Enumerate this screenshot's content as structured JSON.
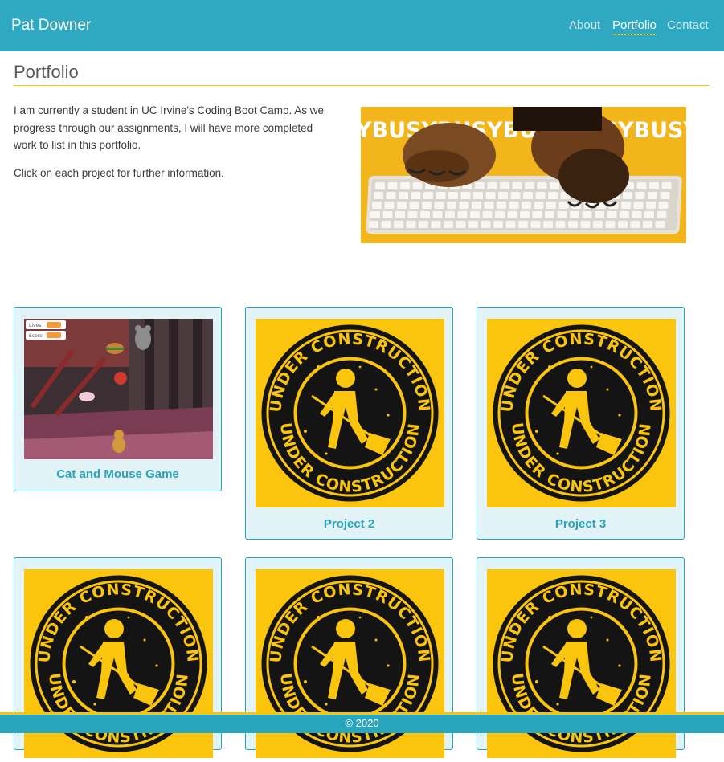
{
  "site": {
    "brand": "Pat Downer"
  },
  "nav": {
    "items": [
      {
        "label": "About",
        "active": false
      },
      {
        "label": "Portfolio",
        "active": true
      },
      {
        "label": "Contact",
        "active": false
      }
    ]
  },
  "page": {
    "title": "Portfolio",
    "intro": [
      "I am currently a student in UC Irvine's Coding Boot Camp. As we progress through our assignments, I will have more completed work to list in this portfolio.",
      "Click on each project for further information."
    ]
  },
  "hero": {
    "banner_text": "YBUSYBUSYBUSYBUSYBUSYBUSYBUSYB"
  },
  "game_thumb": {
    "hud_lives": "Lives",
    "hud_score": "Score"
  },
  "stamp": {
    "text": "UNDER CONSTRUCTION"
  },
  "projects": [
    {
      "title": "Cat and Mouse Game"
    },
    {
      "title": "Project 2"
    },
    {
      "title": "Project 3"
    },
    {
      "title": ""
    },
    {
      "title": ""
    },
    {
      "title": ""
    }
  ],
  "footer": {
    "text": "© 2020"
  },
  "colors": {
    "navbar": "#2ea9c1",
    "accent_yellow": "#f2c512",
    "card_bg": "#e1f3f7",
    "card_border": "#2aa3b8"
  }
}
